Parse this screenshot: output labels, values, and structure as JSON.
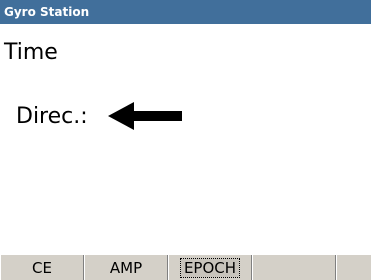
{
  "window": {
    "title": "Gyro Station"
  },
  "main": {
    "heading": "Time",
    "direction_label": "Direc.:",
    "direction_icon": "arrow-left-icon"
  },
  "tabs": [
    {
      "label": "CE",
      "active": false
    },
    {
      "label": "AMP",
      "active": false
    },
    {
      "label": "EPOCH",
      "active": true
    },
    {
      "label": "",
      "active": false
    },
    {
      "label": "",
      "active": false
    }
  ],
  "colors": {
    "titlebar_bg": "#416f9b",
    "titlebar_text": "#ffffff",
    "tabbar_bg": "#d4d0c8",
    "content_bg": "#ffffff"
  }
}
